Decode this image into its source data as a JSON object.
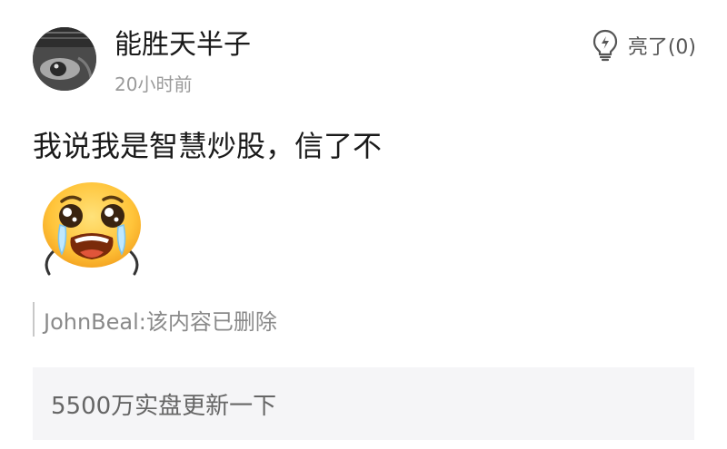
{
  "post": {
    "author": "能胜天半子",
    "timestamp": "20小时前",
    "like_label": "亮了(0)",
    "content": "我说我是智慧炒股，信了不",
    "emoji_icon": "crying-face-emoji"
  },
  "quote": {
    "text": "JohnBeal:该内容已删除"
  },
  "reply": {
    "text": "5500万实盘更新一下"
  },
  "icons": {
    "like": "lightbulb-icon",
    "avatar": "avatar"
  },
  "colors": {
    "text_primary": "#1a1a1a",
    "text_secondary": "#9a9a9a",
    "reply_background": "#f5f5f7"
  }
}
